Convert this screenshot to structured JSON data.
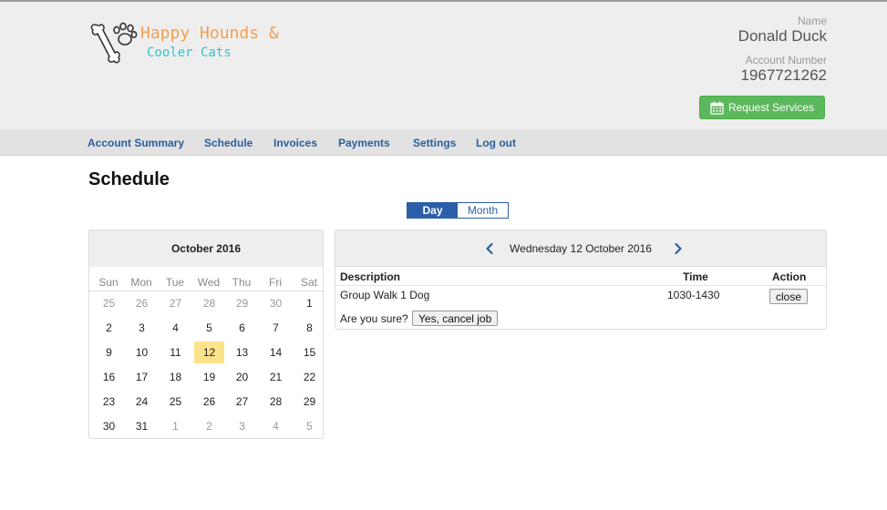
{
  "brand": {
    "line1": "Happy Hounds &",
    "line2": "Cooler Cats"
  },
  "account": {
    "name_label": "Name",
    "name_value": "Donald Duck",
    "number_label": "Account Number",
    "number_value": "1967721262"
  },
  "request_button": {
    "label": "Request Services"
  },
  "nav": {
    "items": [
      {
        "label": "Account Summary"
      },
      {
        "label": "Schedule"
      },
      {
        "label": "Invoices"
      },
      {
        "label": "Payments"
      },
      {
        "label": "Settings"
      },
      {
        "label": "Log out"
      }
    ]
  },
  "page": {
    "title": "Schedule"
  },
  "view_toggle": {
    "day": "Day",
    "month": "Month",
    "selected": "Day"
  },
  "calendar": {
    "month_label": "October 2016",
    "weekdays": [
      "Sun",
      "Mon",
      "Tue",
      "Wed",
      "Thu",
      "Fri",
      "Sat"
    ],
    "weeks": [
      [
        "25",
        "26",
        "27",
        "28",
        "29",
        "30",
        "1"
      ],
      [
        "2",
        "3",
        "4",
        "5",
        "6",
        "7",
        "8"
      ],
      [
        "9",
        "10",
        "11",
        "12",
        "13",
        "14",
        "15"
      ],
      [
        "16",
        "17",
        "18",
        "19",
        "20",
        "21",
        "22"
      ],
      [
        "23",
        "24",
        "25",
        "26",
        "27",
        "28",
        "29"
      ],
      [
        "30",
        "31",
        "1",
        "2",
        "3",
        "4",
        "5"
      ]
    ],
    "selected_day": "12"
  },
  "schedule": {
    "date_prefix": "Wednesday 12",
    "date_month": "October",
    "date_year": "2016",
    "columns": {
      "description": "Description",
      "time": "Time",
      "action": "Action"
    },
    "jobs": [
      {
        "description": "Group Walk 1 Dog",
        "time": "1030-1430",
        "action_label": "close"
      }
    ],
    "confirm_prompt": "Are you sure?",
    "confirm_button": "Yes, cancel job"
  },
  "colors": {
    "accent_blue": "#2b5ea8",
    "green": "#5cb85c",
    "brand_orange": "#f0a150",
    "brand_teal": "#3cbfc6",
    "today_highlight": "#fce28a"
  }
}
